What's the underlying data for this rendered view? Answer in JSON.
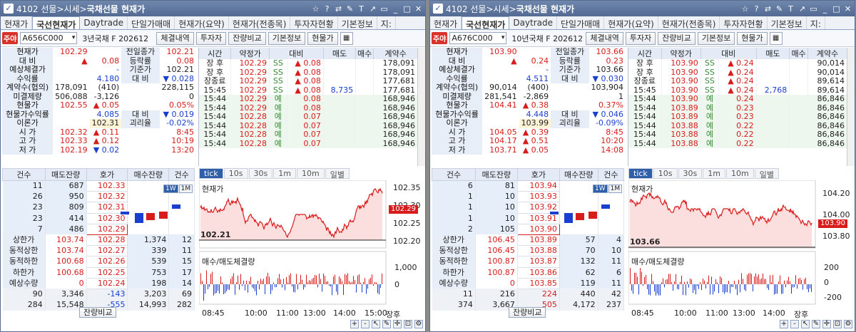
{
  "windows": [
    {
      "title_code": "4102",
      "title_path": "선물>시세>",
      "title_main": "국채선물 현재가",
      "tabs": [
        "현재가",
        "국선현재가",
        "Daytrade",
        "단일가매매",
        "현재가(요약)",
        "현재가(전종목)",
        "투자자현황",
        "기본정보",
        "지:"
      ],
      "badge": "주야",
      "code": "A656C000",
      "product": "3년국채 F 202612",
      "buttons": [
        "체결내역",
        "투자자",
        "잔량비교",
        "기본정보",
        "현물가"
      ],
      "info": [
        [
          "현재가",
          "102.29",
          "",
          "전일종가",
          "102.21"
        ],
        [
          "대  비",
          "▲",
          "0.08",
          "등락률",
          "0.08"
        ],
        [
          "예상체결가",
          "",
          "-",
          "기준가",
          "102.21"
        ],
        [
          "수익률",
          "",
          "4.180",
          "대  비",
          "▼ 0.028"
        ],
        [
          "계약수(협의)",
          "178,091",
          "(410)",
          "",
          "228,115"
        ],
        [
          "미결제량",
          "506,088",
          "-3,126",
          "",
          "0"
        ],
        [
          "현물가",
          "102.55",
          "▲ 0.05",
          "",
          "0.05%"
        ],
        [
          "현물가수익률",
          "",
          "4.085",
          "대  비",
          "▼ 0.019"
        ],
        [
          "이론가",
          "",
          "102.31",
          "괴리율",
          "-0.02%"
        ],
        [
          "시  가",
          "102.32",
          "▲ 0.11",
          "",
          "8:45"
        ],
        [
          "고  가",
          "102.33",
          "▲ 0.12",
          "",
          "10:19"
        ],
        [
          "저  가",
          "102.19",
          "▼ 0.02",
          "",
          "13:20"
        ]
      ],
      "trades_header": [
        "시간",
        "약정가",
        "대비",
        "매도",
        "매수",
        "계약수"
      ],
      "trades": [
        [
          "장 후",
          "102.29",
          "SS",
          "▲ 0.08",
          "",
          "",
          "178,091"
        ],
        [
          "장 후",
          "102.29",
          "SS",
          "▲ 0.08",
          "",
          "",
          "178,091"
        ],
        [
          "장종료",
          "102.29",
          "SS",
          "▲ 0.08",
          "",
          "",
          "177,681"
        ],
        [
          "15:45",
          "102.29",
          "SS",
          "▲ 0.08",
          "8,735",
          "",
          "177,681"
        ],
        [
          "15:44",
          "102.29",
          "예",
          "0.08",
          "",
          "",
          "168,946"
        ],
        [
          "15:44",
          "102.29",
          "예",
          "0.08",
          "",
          "",
          "168,946"
        ],
        [
          "15:44",
          "102.28",
          "예",
          "0.07",
          "",
          "",
          "168,946"
        ],
        [
          "15:44",
          "102.28",
          "예",
          "0.07",
          "",
          "",
          "168,946"
        ],
        [
          "15:44",
          "102.28",
          "예",
          "0.07",
          "",
          "",
          "168,946"
        ],
        [
          "15:44",
          "102.28",
          "예",
          "0.07",
          "",
          "",
          "168,946"
        ]
      ],
      "ob_header": [
        "건수",
        "매도잔량",
        "호가",
        "매수잔량",
        "건수"
      ],
      "asks": [
        [
          "11",
          "687",
          "102.33"
        ],
        [
          "26",
          "950",
          "102.32"
        ],
        [
          "23",
          "809",
          "102.31"
        ],
        [
          "23",
          "414",
          "102.30"
        ],
        [
          "7",
          "486",
          "102.29"
        ]
      ],
      "bids": [
        [
          "상한가",
          "103.74",
          "102.28",
          "1,374",
          "12"
        ],
        [
          "동적상한",
          "103.74",
          "102.27",
          "339",
          "11"
        ],
        [
          "동적하한",
          "100.68",
          "102.26",
          "539",
          "15"
        ],
        [
          "하한가",
          "100.68",
          "102.25",
          "753",
          "17"
        ],
        [
          "예상수량",
          "0",
          "102.24",
          "198",
          "14"
        ]
      ],
      "totals": [
        [
          "90",
          "3,346",
          "-143",
          "3,203",
          "69"
        ],
        [
          "284",
          "15,548",
          "-555",
          "14,993",
          "282"
        ]
      ],
      "compare_label": "잔량비교",
      "chart_tabs": [
        "tick",
        "10s",
        "30s",
        "1m",
        "10m",
        "일별"
      ],
      "chart_title": "현재가",
      "vol_title": "매수/매도체결량",
      "yticks": [
        "102.35",
        "102.30",
        "102.25",
        "102.20"
      ],
      "last_tag": "102.29",
      "base_label": "102.21",
      "vyticks": [
        "1,000",
        "0"
      ],
      "xticks": [
        "08:45",
        "10:00",
        "11:00",
        "13:00",
        "14:00",
        "15:00",
        "장후"
      ],
      "week_btns": [
        "1W",
        "1M"
      ]
    },
    {
      "title_code": "4102",
      "title_path": "선물>시세>",
      "title_main": "국채선물 현재가",
      "tabs": [
        "현재가",
        "국선현재가",
        "Daytrade",
        "단일가매매",
        "현재가(요약)",
        "현재가(전종목)",
        "투자자현황",
        "기본정보",
        "지:"
      ],
      "badge": "주야",
      "code": "A676C000",
      "product": "10년국채 F 202612",
      "buttons": [
        "체결내역",
        "투자자",
        "잔량비교",
        "기본정보",
        "현물가"
      ],
      "info": [
        [
          "현재가",
          "103.90",
          "",
          "전일종가",
          "103.66"
        ],
        [
          "대  비",
          "▲",
          "0.24",
          "등락률",
          "0.23"
        ],
        [
          "예상체결가",
          "",
          "-",
          "기준가",
          "103.66"
        ],
        [
          "수익률",
          "",
          "4.511",
          "대  비",
          "▼ 0.030"
        ],
        [
          "계약수(협의)",
          "90,014",
          "(400)",
          "",
          "103,904"
        ],
        [
          "미결제량",
          "281,541",
          "-2,869",
          "",
          "1"
        ],
        [
          "현물가",
          "104.41",
          "▲ 0.38",
          "",
          "0.37%"
        ],
        [
          "현물가수익률",
          "",
          "4.448",
          "대  비",
          "▼ 0.046"
        ],
        [
          "이론가",
          "",
          "103.99",
          "괴리율",
          "-0.09%"
        ],
        [
          "시  가",
          "104.05",
          "▲ 0.39",
          "",
          "8:45"
        ],
        [
          "고  가",
          "104.17",
          "▲ 0.51",
          "",
          "10:20"
        ],
        [
          "저  가",
          "103.71",
          "▲ 0.05",
          "",
          "14:08"
        ]
      ],
      "trades_header": [
        "시간",
        "약정가",
        "대비",
        "매도",
        "매수",
        "계약수"
      ],
      "trades": [
        [
          "장 후",
          "103.90",
          "SS",
          "▲ 0.24",
          "",
          "",
          "90,014"
        ],
        [
          "장 후",
          "103.90",
          "SS",
          "▲ 0.24",
          "",
          "",
          "90,014"
        ],
        [
          "장종료",
          "103.90",
          "SS",
          "▲ 0.24",
          "",
          "",
          "89,614"
        ],
        [
          "15:45",
          "103.90",
          "SS",
          "▲ 0.24",
          "2,768",
          "",
          "89,614"
        ],
        [
          "15:44",
          "103.90",
          "예",
          "0.24",
          "",
          "",
          "86,846"
        ],
        [
          "15:44",
          "103.89",
          "예",
          "0.23",
          "",
          "",
          "86,846"
        ],
        [
          "15:44",
          "103.89",
          "예",
          "0.23",
          "",
          "",
          "86,846"
        ],
        [
          "15:44",
          "103.88",
          "예",
          "0.22",
          "",
          "",
          "86,846"
        ],
        [
          "15:44",
          "103.88",
          "예",
          "0.22",
          "",
          "",
          "86,846"
        ],
        [
          "15:44",
          "103.88",
          "예",
          "0.22",
          "",
          "",
          "86,846"
        ]
      ],
      "ob_header": [
        "건수",
        "매도잔량",
        "호가",
        "매수잔량",
        "건수"
      ],
      "asks": [
        [
          "6",
          "81",
          "103.94"
        ],
        [
          "1",
          "10",
          "103.93"
        ],
        [
          "1",
          "10",
          "103.92"
        ],
        [
          "1",
          "10",
          "103.91"
        ],
        [
          "2",
          "105",
          "103.90"
        ]
      ],
      "bids": [
        [
          "상한가",
          "106.45",
          "103.89",
          "57",
          "4"
        ],
        [
          "동적상한",
          "106.45",
          "103.88",
          "70",
          "10"
        ],
        [
          "동적하한",
          "100.87",
          "103.87",
          "132",
          "11"
        ],
        [
          "하한가",
          "100.87",
          "103.86",
          "62",
          "6"
        ],
        [
          "예상수량",
          "0",
          "103.85",
          "119",
          "11"
        ]
      ],
      "totals": [
        [
          "11",
          "216",
          "224",
          "440",
          "42"
        ],
        [
          "374",
          "3,667",
          "505",
          "4,172",
          "237"
        ]
      ],
      "compare_label": "잔량비교",
      "chart_tabs": [
        "tick",
        "10s",
        "30s",
        "1m",
        "10m",
        "일별"
      ],
      "chart_title": "현재가",
      "vol_title": "매수/매도체결량",
      "yticks": [
        "104.20",
        "104.00",
        "103.80"
      ],
      "last_tag": "103.90",
      "base_label": "103.66",
      "vyticks": [
        "200",
        "0",
        "-200"
      ],
      "xticks": [
        "08:45",
        "10:00",
        "11:00",
        "13:00",
        "14:00",
        "장후"
      ],
      "week_btns": [
        "1W",
        "1M"
      ]
    }
  ],
  "colors": {
    "up": "#d81c1c",
    "down": "#1a3fd0",
    "title_bar": "#5f76a0",
    "label_bg": "#e8eef8"
  }
}
